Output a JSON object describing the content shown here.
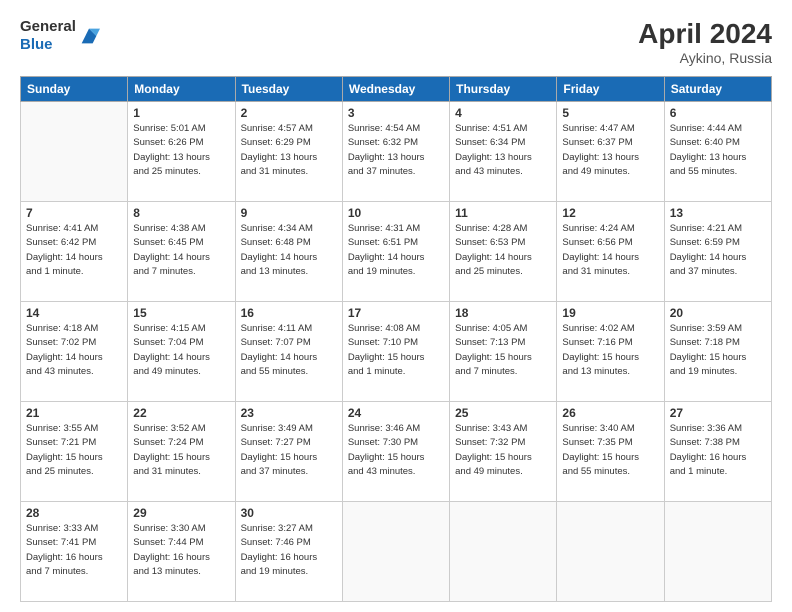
{
  "header": {
    "logo_line1": "General",
    "logo_line2": "Blue",
    "month": "April 2024",
    "location": "Aykino, Russia"
  },
  "weekdays": [
    "Sunday",
    "Monday",
    "Tuesday",
    "Wednesday",
    "Thursday",
    "Friday",
    "Saturday"
  ],
  "weeks": [
    [
      {
        "day": "",
        "info": ""
      },
      {
        "day": "1",
        "info": "Sunrise: 5:01 AM\nSunset: 6:26 PM\nDaylight: 13 hours\nand 25 minutes."
      },
      {
        "day": "2",
        "info": "Sunrise: 4:57 AM\nSunset: 6:29 PM\nDaylight: 13 hours\nand 31 minutes."
      },
      {
        "day": "3",
        "info": "Sunrise: 4:54 AM\nSunset: 6:32 PM\nDaylight: 13 hours\nand 37 minutes."
      },
      {
        "day": "4",
        "info": "Sunrise: 4:51 AM\nSunset: 6:34 PM\nDaylight: 13 hours\nand 43 minutes."
      },
      {
        "day": "5",
        "info": "Sunrise: 4:47 AM\nSunset: 6:37 PM\nDaylight: 13 hours\nand 49 minutes."
      },
      {
        "day": "6",
        "info": "Sunrise: 4:44 AM\nSunset: 6:40 PM\nDaylight: 13 hours\nand 55 minutes."
      }
    ],
    [
      {
        "day": "7",
        "info": "Sunrise: 4:41 AM\nSunset: 6:42 PM\nDaylight: 14 hours\nand 1 minute."
      },
      {
        "day": "8",
        "info": "Sunrise: 4:38 AM\nSunset: 6:45 PM\nDaylight: 14 hours\nand 7 minutes."
      },
      {
        "day": "9",
        "info": "Sunrise: 4:34 AM\nSunset: 6:48 PM\nDaylight: 14 hours\nand 13 minutes."
      },
      {
        "day": "10",
        "info": "Sunrise: 4:31 AM\nSunset: 6:51 PM\nDaylight: 14 hours\nand 19 minutes."
      },
      {
        "day": "11",
        "info": "Sunrise: 4:28 AM\nSunset: 6:53 PM\nDaylight: 14 hours\nand 25 minutes."
      },
      {
        "day": "12",
        "info": "Sunrise: 4:24 AM\nSunset: 6:56 PM\nDaylight: 14 hours\nand 31 minutes."
      },
      {
        "day": "13",
        "info": "Sunrise: 4:21 AM\nSunset: 6:59 PM\nDaylight: 14 hours\nand 37 minutes."
      }
    ],
    [
      {
        "day": "14",
        "info": "Sunrise: 4:18 AM\nSunset: 7:02 PM\nDaylight: 14 hours\nand 43 minutes."
      },
      {
        "day": "15",
        "info": "Sunrise: 4:15 AM\nSunset: 7:04 PM\nDaylight: 14 hours\nand 49 minutes."
      },
      {
        "day": "16",
        "info": "Sunrise: 4:11 AM\nSunset: 7:07 PM\nDaylight: 14 hours\nand 55 minutes."
      },
      {
        "day": "17",
        "info": "Sunrise: 4:08 AM\nSunset: 7:10 PM\nDaylight: 15 hours\nand 1 minute."
      },
      {
        "day": "18",
        "info": "Sunrise: 4:05 AM\nSunset: 7:13 PM\nDaylight: 15 hours\nand 7 minutes."
      },
      {
        "day": "19",
        "info": "Sunrise: 4:02 AM\nSunset: 7:16 PM\nDaylight: 15 hours\nand 13 minutes."
      },
      {
        "day": "20",
        "info": "Sunrise: 3:59 AM\nSunset: 7:18 PM\nDaylight: 15 hours\nand 19 minutes."
      }
    ],
    [
      {
        "day": "21",
        "info": "Sunrise: 3:55 AM\nSunset: 7:21 PM\nDaylight: 15 hours\nand 25 minutes."
      },
      {
        "day": "22",
        "info": "Sunrise: 3:52 AM\nSunset: 7:24 PM\nDaylight: 15 hours\nand 31 minutes."
      },
      {
        "day": "23",
        "info": "Sunrise: 3:49 AM\nSunset: 7:27 PM\nDaylight: 15 hours\nand 37 minutes."
      },
      {
        "day": "24",
        "info": "Sunrise: 3:46 AM\nSunset: 7:30 PM\nDaylight: 15 hours\nand 43 minutes."
      },
      {
        "day": "25",
        "info": "Sunrise: 3:43 AM\nSunset: 7:32 PM\nDaylight: 15 hours\nand 49 minutes."
      },
      {
        "day": "26",
        "info": "Sunrise: 3:40 AM\nSunset: 7:35 PM\nDaylight: 15 hours\nand 55 minutes."
      },
      {
        "day": "27",
        "info": "Sunrise: 3:36 AM\nSunset: 7:38 PM\nDaylight: 16 hours\nand 1 minute."
      }
    ],
    [
      {
        "day": "28",
        "info": "Sunrise: 3:33 AM\nSunset: 7:41 PM\nDaylight: 16 hours\nand 7 minutes."
      },
      {
        "day": "29",
        "info": "Sunrise: 3:30 AM\nSunset: 7:44 PM\nDaylight: 16 hours\nand 13 minutes."
      },
      {
        "day": "30",
        "info": "Sunrise: 3:27 AM\nSunset: 7:46 PM\nDaylight: 16 hours\nand 19 minutes."
      },
      {
        "day": "",
        "info": ""
      },
      {
        "day": "",
        "info": ""
      },
      {
        "day": "",
        "info": ""
      },
      {
        "day": "",
        "info": ""
      }
    ]
  ]
}
